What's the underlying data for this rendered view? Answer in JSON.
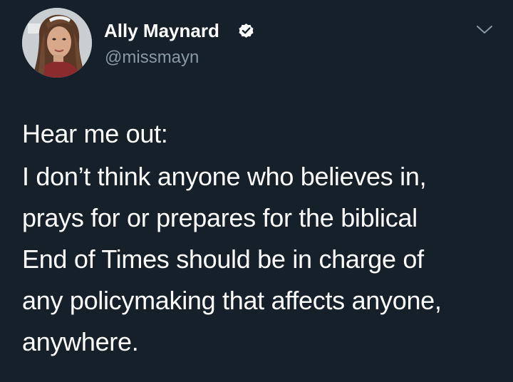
{
  "tweet": {
    "author": {
      "display_name": "Ally Maynard",
      "handle": "@missmayn",
      "verified": true,
      "avatar_icon": "profile-photo"
    },
    "menu_icon": "chevron-down-icon",
    "text": {
      "intro": "Hear me out:",
      "body": "I don’t think anyone who believes in,\nprays for or prepares for the biblical\nEnd of Times should be in charge of\nany policymaking that affects anyone,\nanywhere."
    }
  },
  "colors": {
    "background": "#15202b",
    "text_primary": "#ffffff",
    "text_secondary": "#8899a6",
    "verified_badge": "#ffffff"
  }
}
